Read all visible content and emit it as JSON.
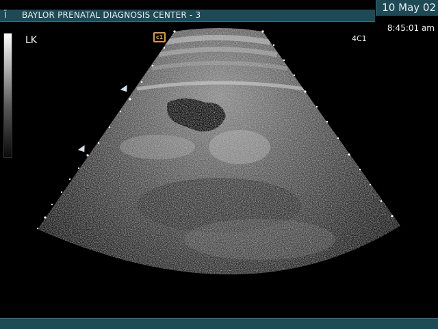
{
  "header": {
    "logo_icon": "probe-icon",
    "logo_glyph": "Ĩ",
    "title": "BAYLOR PRENATAL DIAGNOSIS CENTER - 3",
    "date": "10 May 02",
    "time": "8:45:01 am"
  },
  "image_info": {
    "side_label": "LK",
    "probe": "4C1",
    "orientation_mark": "c1"
  },
  "colors": {
    "bar": "#1e4a55",
    "marker": "#e0a020",
    "text": "#e9f0f2"
  }
}
